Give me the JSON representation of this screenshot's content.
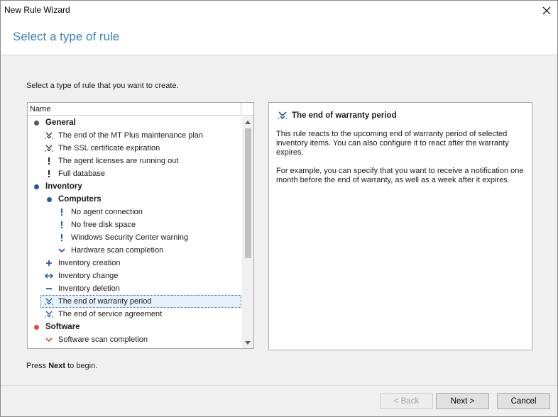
{
  "window": {
    "title": "New Rule Wizard"
  },
  "header": {
    "title": "Select a type of rule"
  },
  "instruction": "Select a type of rule that you want to create.",
  "tree": {
    "column_name": "Name",
    "rows": [
      {
        "label": "General",
        "level": 0,
        "group": true,
        "icon": "bullet-gray-icon"
      },
      {
        "label": "The end of the MT Plus maintenance plan",
        "level": 1,
        "icon": "clock-expire-icon"
      },
      {
        "label": "The SSL certificate expiration",
        "level": 1,
        "icon": "clock-expire-icon"
      },
      {
        "label": "The agent licenses are running out",
        "level": 1,
        "icon": "exclamation-icon"
      },
      {
        "label": "Full database",
        "level": 1,
        "icon": "exclamation-icon"
      },
      {
        "label": "Inventory",
        "level": 0,
        "group": true,
        "icon": "bullet-blue-icon"
      },
      {
        "label": "Computers",
        "level": 1,
        "group": true,
        "icon": "bullet-blue-icon"
      },
      {
        "label": "No agent connection",
        "level": 2,
        "icon": "exclamation-blue-icon"
      },
      {
        "label": "No free disk space",
        "level": 2,
        "icon": "exclamation-blue-icon"
      },
      {
        "label": "Windows Security Center warning",
        "level": 2,
        "icon": "exclamation-blue-icon"
      },
      {
        "label": "Hardware scan completion",
        "level": 2,
        "icon": "checkmark-blue-icon"
      },
      {
        "label": "Inventory creation",
        "level": 1,
        "icon": "plus-icon"
      },
      {
        "label": "Inventory change",
        "level": 1,
        "icon": "double-arrow-icon"
      },
      {
        "label": "Inventory deletion",
        "level": 1,
        "icon": "minus-icon"
      },
      {
        "label": "The end of warranty period",
        "level": 1,
        "icon": "clock-expire-blue-icon",
        "selected": true
      },
      {
        "label": "The end of service agreement",
        "level": 1,
        "icon": "clock-expire-blue-icon"
      },
      {
        "label": "Software",
        "level": 0,
        "group": true,
        "icon": "bullet-red-icon"
      },
      {
        "label": "Software scan completion",
        "level": 1,
        "icon": "checkmark-red-icon"
      }
    ]
  },
  "description": {
    "title": "The end of warranty period",
    "para1": "This rule reacts to the upcoming end of warranty period of selected inventory items. You can also configure it to react after the warranty expires.",
    "para2": "For example, you can specify that you want to receive a notification one month before the end of warranty, as well as a week after it expires."
  },
  "press_prefix": "Press ",
  "press_bold": "Next",
  "press_suffix": " to begin.",
  "buttons": {
    "back": "< Back",
    "next": "Next >",
    "cancel": "Cancel"
  },
  "colors": {
    "accent": "#3a82c4",
    "blue": "#1f5aa6",
    "red": "#d9503f",
    "gray": "#555555"
  }
}
